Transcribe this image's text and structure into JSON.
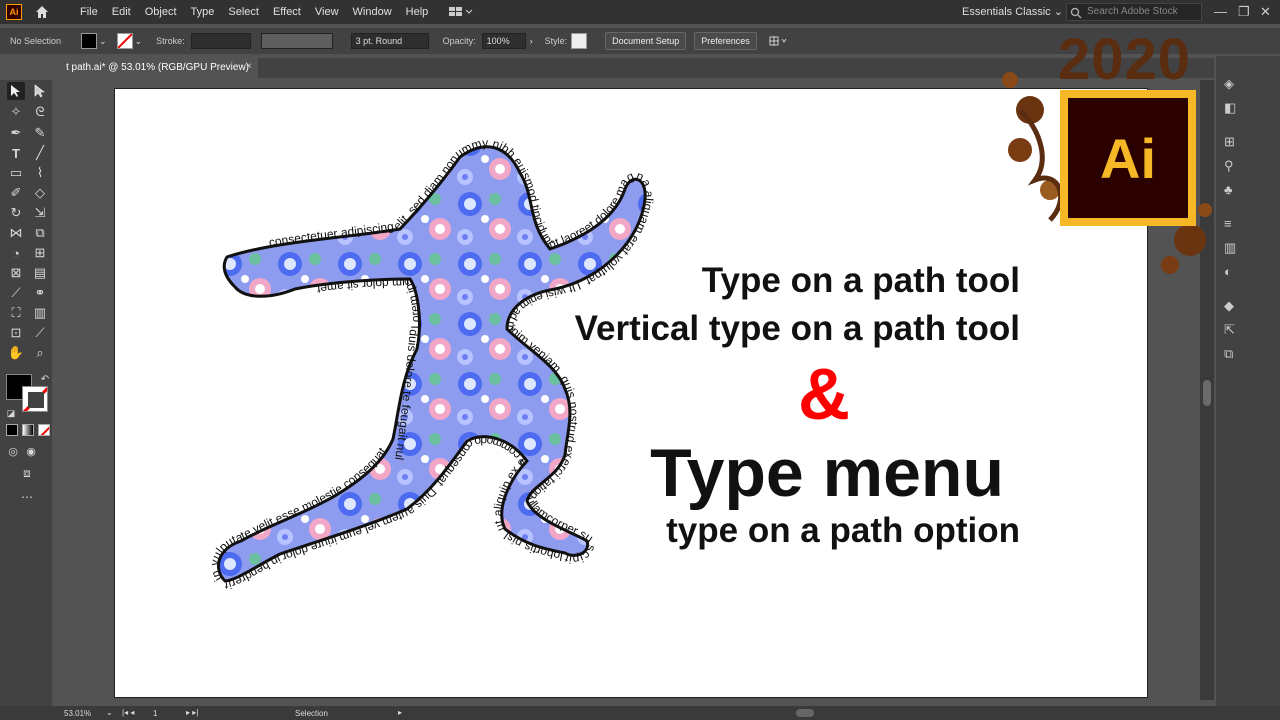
{
  "app": {
    "badge": "Ai"
  },
  "menu": [
    "File",
    "Edit",
    "Object",
    "Type",
    "Select",
    "Effect",
    "View",
    "Window",
    "Help"
  ],
  "workspace": "Essentials Classic",
  "stock_search": {
    "placeholder": "Search Adobe Stock"
  },
  "control": {
    "selection": "No Selection",
    "stroke_label": "Stroke:",
    "brush": "3 pt. Round",
    "opacity_label": "Opacity:",
    "opacity": "100%",
    "style_label": "Style:",
    "document_setup": "Document Setup",
    "preferences": "Preferences"
  },
  "tab": {
    "title": "t path.ai* @ 53.01% (RGB/GPU Preview)",
    "close": "×"
  },
  "artwork": {
    "line1": "Type on a path tool",
    "line2": "Vertical type on a path tool",
    "ampersand": "&",
    "line3": "Type menu",
    "line4": "type on a path option",
    "path_text_top": "consectetuer adipiscing elit, sed diam nonummy nibh euismod tincidunt ut laoreet dolore magna aliquam erat volutpat. Ut wisi enim ad minim veniam,",
    "path_text_left": "Lorem ipsum dolor sit amet",
    "path_text_mid": "quis nostrud exerci tation ullamcorper suscipit lobortis nisl ut aliquip ex ea commodo consequat. Duis autem vel eum iriure dolor in hendrerit in vulputate velit esse molestie consequat",
    "path_text_leg": "duis dolore te feugait nulla facilisi"
  },
  "badge": {
    "year": "2020",
    "logo": "Ai"
  },
  "status": {
    "zoom": "53.01%",
    "artboard": "1",
    "tool": "Selection"
  },
  "colors": {
    "chrome_dark": "#323232",
    "panel": "#424242",
    "pasteboard": "#535353",
    "ampersand": "#ff0000",
    "ai_gold": "#f6b826"
  }
}
